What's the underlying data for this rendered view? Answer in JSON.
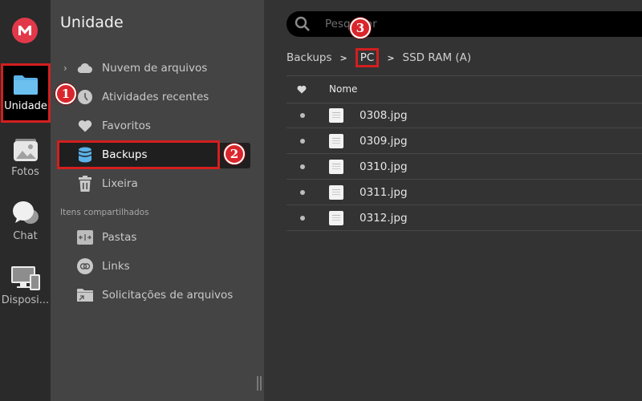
{
  "rail": {
    "items": [
      {
        "label": "Unidade",
        "icon": "folder-icon",
        "active": true
      },
      {
        "label": "Fotos",
        "icon": "photos-icon"
      },
      {
        "label": "Chat",
        "icon": "chat-icon"
      },
      {
        "label": "Disposi...",
        "icon": "devices-icon"
      }
    ]
  },
  "sidebar": {
    "title": "Unidade",
    "items": [
      {
        "label": "Nuvem de arquivos",
        "icon": "cloud-icon"
      },
      {
        "label": "Atividades recentes",
        "icon": "clock-icon"
      },
      {
        "label": "Favoritos",
        "icon": "heart-icon"
      },
      {
        "label": "Backups",
        "icon": "database-icon",
        "selected": true
      },
      {
        "label": "Lixeira",
        "icon": "trash-icon"
      }
    ],
    "shared_section_label": "Itens compartilhados",
    "shared_items": [
      {
        "label": "Pastas",
        "icon": "shared-folder-icon"
      },
      {
        "label": "Links",
        "icon": "link-icon"
      },
      {
        "label": "Solicitações de arquivos",
        "icon": "file-request-icon"
      }
    ]
  },
  "main": {
    "search_placeholder": "Pesquisar",
    "breadcrumb": [
      "Backups",
      "PC",
      "SSD RAM (A)"
    ],
    "column_name": "Nome",
    "files": [
      {
        "name": "0308.jpg"
      },
      {
        "name": "0309.jpg"
      },
      {
        "name": "0310.jpg"
      },
      {
        "name": "0311.jpg"
      },
      {
        "name": "0312.jpg"
      }
    ]
  },
  "annotations": [
    "1",
    "2",
    "3"
  ],
  "colors": {
    "brand": "#e2394a",
    "highlight": "#d31f1f",
    "accent_blue": "#5bb2e8"
  }
}
